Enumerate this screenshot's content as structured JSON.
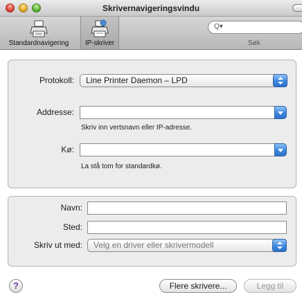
{
  "window": {
    "title": "Skrivernavigeringsvindu"
  },
  "toolbar": {
    "items": [
      {
        "label": "Standardnavigering",
        "icon": "printer-icon"
      },
      {
        "label": "IP-skriver",
        "icon": "network-printer-icon"
      }
    ],
    "search": {
      "placeholder": "",
      "glyph": "Q▾",
      "label": "Søk"
    }
  },
  "connection": {
    "protocol_label": "Protokoll:",
    "protocol_value": "Line Printer Daemon – LPD",
    "address_label": "Addresse:",
    "address_value": "",
    "address_hint": "Skriv inn vertsnavn eller IP-adresse.",
    "queue_label": "Kø:",
    "queue_value": "",
    "queue_hint": "La stå tom for standardkø."
  },
  "details": {
    "name_label": "Navn:",
    "name_value": "",
    "location_label": "Sted:",
    "location_value": "",
    "print_using_label": "Skriv ut med:",
    "print_using_value": "Velg en driver eller skrivermodell"
  },
  "buttons": {
    "help": "?",
    "more_printers": "Flere skrivere...",
    "add": "Legg til"
  },
  "colors": {
    "accent": "#3c86de"
  }
}
